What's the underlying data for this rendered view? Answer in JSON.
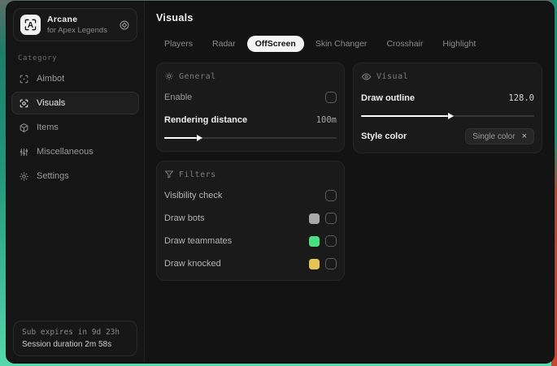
{
  "sidebar": {
    "logo_letter": "A",
    "title": "Arcane",
    "subtitle": "for Apex Legends",
    "category_label": "Category",
    "items": [
      {
        "label": "Aimbot"
      },
      {
        "label": "Visuals"
      },
      {
        "label": "Items"
      },
      {
        "label": "Miscellaneous"
      },
      {
        "label": "Settings"
      }
    ],
    "footer": {
      "sub_expires": "Sub expires in 9d 23h",
      "session_duration": "Session duration 2m 58s"
    }
  },
  "main": {
    "title": "Visuals",
    "tabs": [
      {
        "label": "Players"
      },
      {
        "label": "Radar"
      },
      {
        "label": "OffScreen"
      },
      {
        "label": "Skin Changer"
      },
      {
        "label": "Crosshair"
      },
      {
        "label": "Highlight"
      }
    ],
    "active_tab": "OffScreen",
    "panels": {
      "general": {
        "title": "General",
        "enable_label": "Enable",
        "enable_checked": false,
        "rendering_distance_label": "Rendering distance",
        "rendering_distance_value": "100m",
        "rendering_distance_percent": 19
      },
      "visual": {
        "title": "Visual",
        "draw_outline_label": "Draw outline",
        "draw_outline_value": "128.0",
        "draw_outline_percent": 50,
        "style_color_label": "Style color",
        "style_color_value": "Single color",
        "clear_glyph": "×"
      },
      "filters": {
        "title": "Filters",
        "rows": [
          {
            "label": "Visibility check",
            "checked": false
          },
          {
            "label": "Draw bots",
            "swatch": "#a8a8a8",
            "checked": false
          },
          {
            "label": "Draw teammates",
            "swatch": "#4ade80",
            "checked": false
          },
          {
            "label": "Draw knocked",
            "swatch": "#e4c455",
            "checked": false
          }
        ]
      }
    }
  },
  "colors": {
    "accent_bg_top": "#197f68",
    "accent_bg_bottom": "#55d9ac",
    "accent_bg_red": "#c44733",
    "window_bg": "#131313",
    "panel_bg": "#1a1a1a"
  }
}
